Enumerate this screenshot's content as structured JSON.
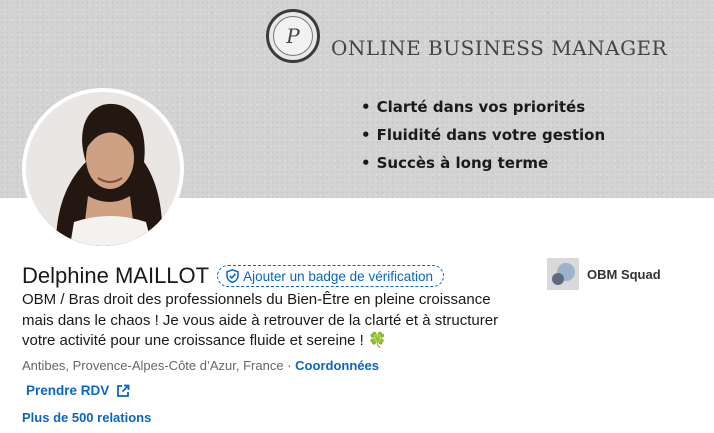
{
  "banner": {
    "logo_letters": "P",
    "brand_title": "ONLINE BUSINESS MANAGER",
    "bullets": [
      "Clarté dans vos priorités",
      "Fluidité dans votre gestion",
      "Succès à long terme"
    ]
  },
  "profile": {
    "name": "Delphine MAILLOT",
    "verification_badge": "Ajouter un badge de vérification",
    "headline_line1": "OBM / Bras droit des professionnels du Bien-Être en pleine croissance",
    "headline_line2": "mais dans le chaos ! Je vous aide à retrouver de la clarté et à structurer",
    "headline_line3": "votre activité pour une croissance fluide et sereine !",
    "headline_emoji": "🍀",
    "location": "Antibes, Provence-Alpes-Côte d’Azur, France",
    "separator": "·",
    "contact_link": "Coordonnées",
    "rdv_link": "Prendre RDV",
    "relations": "Plus de 500 relations"
  },
  "company": {
    "name": "OBM Squad"
  },
  "colors": {
    "link": "#0a66c2",
    "banner_bg": "#d3d3d3",
    "text": "#191919",
    "muted": "#666666"
  },
  "icons": {
    "verify": "shield-check-icon",
    "external": "external-link-icon"
  }
}
